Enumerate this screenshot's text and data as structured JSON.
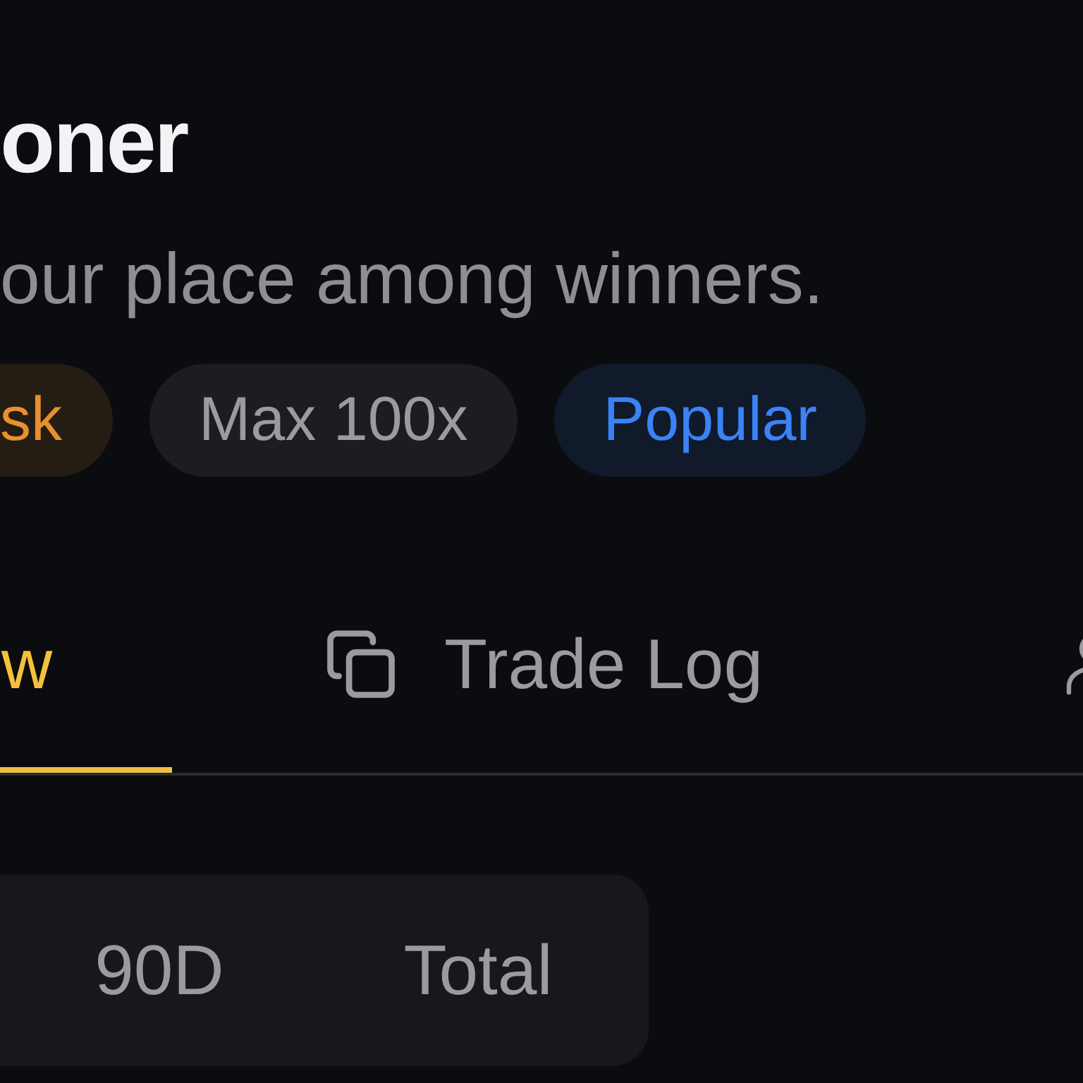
{
  "header": {
    "title": "oner",
    "subtitle": "our place among winners."
  },
  "tags": [
    {
      "label": "sk",
      "color": "#e8902f"
    },
    {
      "label": "Max 100x",
      "color": "#9a9ba0"
    },
    {
      "label": "Popular",
      "color": "#3b82f6"
    }
  ],
  "tabs": [
    {
      "label": "w",
      "selected": true
    },
    {
      "label": "Trade Log",
      "selected": false
    },
    {
      "selected": false
    }
  ],
  "periods": [
    {
      "label": "90D",
      "selected": false
    },
    {
      "label": "Total",
      "selected": false
    }
  ]
}
